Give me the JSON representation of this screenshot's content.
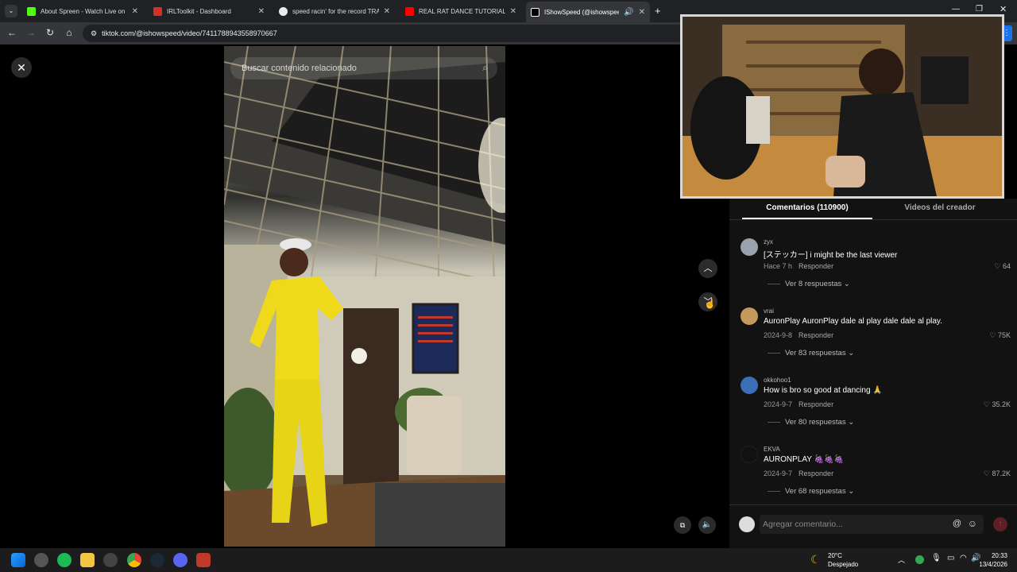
{
  "browser": {
    "tabs": [
      {
        "title": "About Spreen - Watch Live on Kick",
        "color": "#53fc18"
      },
      {
        "title": "IRLToolkit - Dashboard",
        "color": "#d93025"
      },
      {
        "title": "speed racin' for the record TRACK",
        "color": "#e8eaed"
      },
      {
        "title": "REAL RAT DANCE TUTORIAL",
        "color": "#ff0000"
      },
      {
        "title": "IShowSpeed (@ishowspeed)",
        "color": "#ffffff"
      }
    ],
    "url": "tiktok.com/@ishowspeed/video/7411788943558970667"
  },
  "video": {
    "search_placeholder": "Buscar contenido relacionado"
  },
  "comments_panel": {
    "tab_comments": "Comentarios (110900)",
    "tab_creator": "Videos del creador",
    "comments": [
      {
        "user": "zyx",
        "text": "[ステッカー] i might be the last viewer",
        "date": "Hace 7 h",
        "reply": "Responder",
        "likes": "64",
        "replies": "Ver 8 respuestas",
        "avatar_color": "#9aa3ad"
      },
      {
        "user": "vrai",
        "text": "AuronPlay AuronPlay dale al play dale dale al play.",
        "date": "2024-9-8",
        "reply": "Responder",
        "likes": "75K",
        "replies": "Ver 83 respuestas",
        "avatar_color": "#c49a5a"
      },
      {
        "user": "okkohoo1",
        "text": "How is bro so good at dancing 🙏",
        "date": "2024-9-7",
        "reply": "Responder",
        "likes": "35.2K",
        "replies": "Ver 80 respuestas",
        "avatar_color": "#3b6fb5"
      },
      {
        "user": "EKVA",
        "text": "AURONPLAY 🍇🍇🍇",
        "date": "2024-9-7",
        "reply": "Responder",
        "likes": "87.2K",
        "replies": "Ver 68 respuestas",
        "avatar_color": "#111111"
      }
    ],
    "input_placeholder": "Agregar comentario..."
  },
  "taskbar": {
    "weather_temp": "20°C",
    "weather_desc": "Despejado",
    "time": "20:33",
    "date": "13/4/2026"
  }
}
